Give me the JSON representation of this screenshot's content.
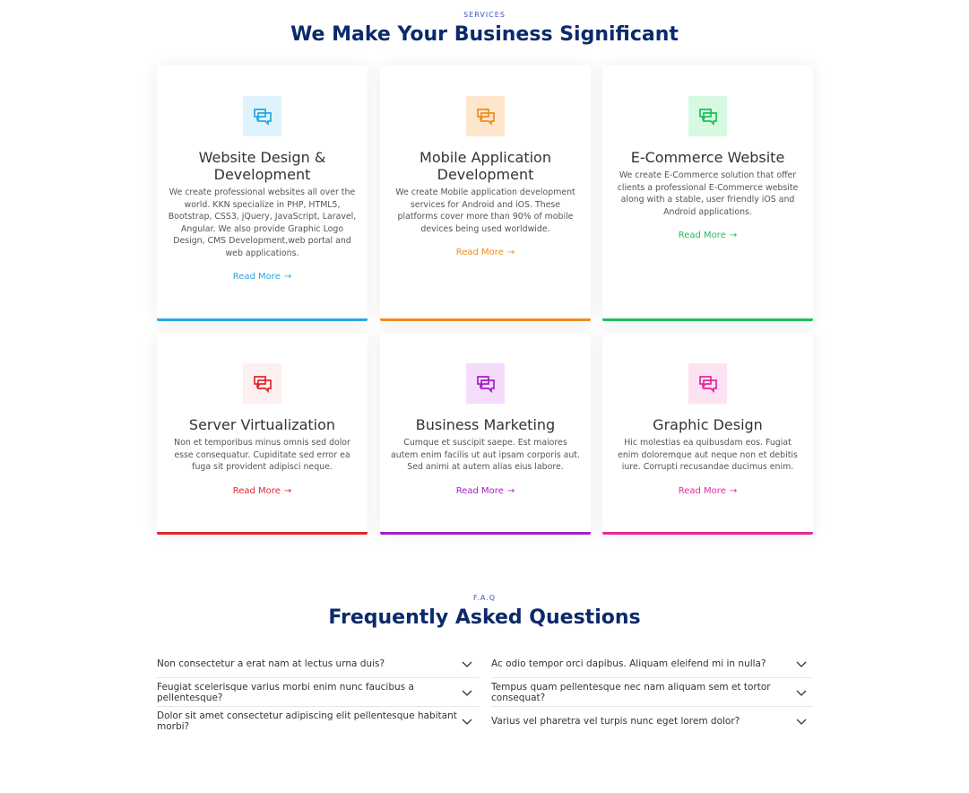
{
  "services": {
    "tag": "SERVICES",
    "title": "We Make Your Business Significant",
    "cards": [
      {
        "title": "Website Design & Development",
        "text": "We create professional websites all over the world. KKN specialize in PHP, HTML5, Bootstrap, CSS3, jQuery, JavaScript, Laravel, Angular. We also provide Graphic Logo Design, CMS Development,web portal and web applications.",
        "link": "Read More",
        "icon": "chat-icon",
        "color": "#2aa7e0",
        "bg": "#dff3fd"
      },
      {
        "title": "Mobile Application Development",
        "text": "We create Mobile application development services for Android and iOS. These platforms cover more than 90% of mobile devices being used worldwide.",
        "link": "Read More",
        "icon": "chat-icon",
        "color": "#f08c1e",
        "bg": "#fde6cc"
      },
      {
        "title": "E-Commerce Website",
        "text": "We create E-Commerce solution that offer clients a professional E-Commerce website along with a stable, user friendly iOS and Android applications.",
        "link": "Read More",
        "icon": "chat-icon",
        "color": "#1fbf5a",
        "bg": "#d7f9e2"
      },
      {
        "title": "Server Virtualization",
        "text": "Non et temporibus minus omnis sed dolor esse consequatur. Cupiditate sed error ea fuga sit provident adipisci neque.",
        "link": "Read More",
        "icon": "chat-icon",
        "color": "#e0262f",
        "bg": "#fdf0f0"
      },
      {
        "title": "Business Marketing",
        "text": "Cumque et suscipit saepe. Est maiores autem enim facilis ut aut ipsam corporis aut. Sed animi at autem alias eius labore.",
        "link": "Read More",
        "icon": "chat-icon",
        "color": "#a51fc7",
        "bg": "#f5dcfa"
      },
      {
        "title": "Graphic Design",
        "text": "Hic molestias ea quibusdam eos. Fugiat enim doloremque aut neque non et debitis iure. Corrupti recusandae ducimus enim.",
        "link": "Read More",
        "icon": "chat-icon",
        "color": "#e32a9a",
        "bg": "#fde2f1"
      }
    ]
  },
  "faq": {
    "tag": "F.A.Q",
    "title": "Frequently Asked Questions",
    "left": [
      "Non consectetur a erat nam at lectus urna duis?",
      "Feugiat scelerisque varius morbi enim nunc faucibus a pellentesque?",
      "Dolor sit amet consectetur adipiscing elit pellentesque habitant morbi?"
    ],
    "right": [
      "Ac odio tempor orci dapibus. Aliquam eleifend mi in nulla?",
      "Tempus quam pellentesque nec nam aliquam sem et tortor consequat?",
      "Varius vel pharetra vel turpis nunc eget lorem dolor?"
    ],
    "chevron_icon": "chevron-down-icon"
  }
}
